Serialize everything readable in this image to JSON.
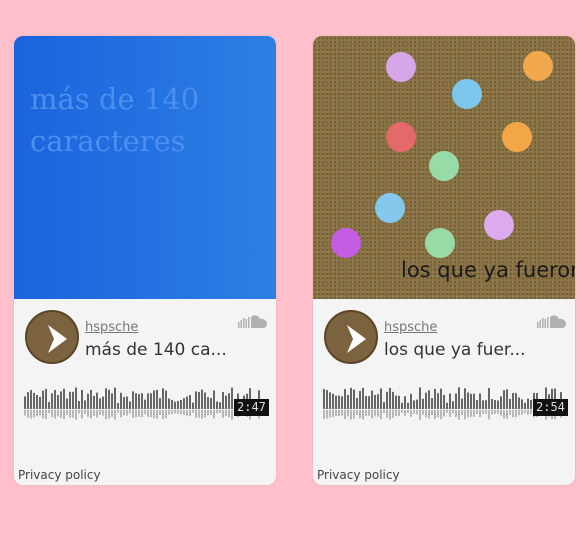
{
  "widgets": [
    {
      "artwork_text": "más de 140\ncaracteres",
      "uploader": "hspsche",
      "title": "más de 140 ca...",
      "duration": "2:47",
      "privacy_label": "Privacy policy",
      "play_icon": "play-icon",
      "brand_icon": "soundcloud-icon"
    },
    {
      "artwork_text": "los que ya fueron",
      "uploader": "hspsche",
      "title": "los que ya fuer...",
      "duration": "2:54",
      "privacy_label": "Privacy policy",
      "play_icon": "play-icon",
      "brand_icon": "soundcloud-icon"
    }
  ],
  "colors": {
    "page_background": "#ffc0cb",
    "card_background": "#f4f4f4",
    "play_button": "#7c6340",
    "artwork_blue": "#1b64dc",
    "artwork_cork": "#8a7344"
  }
}
